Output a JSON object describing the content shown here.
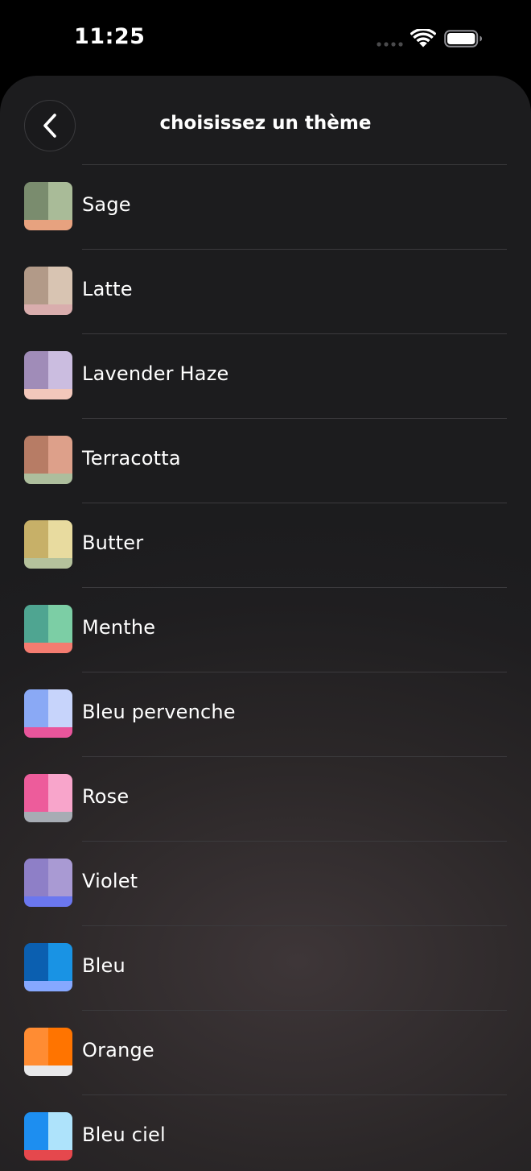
{
  "status_bar": {
    "time": "11:25",
    "icons": [
      "cellular-signal-icon",
      "wifi-icon",
      "battery-icon"
    ]
  },
  "header": {
    "title": "choisissez un thème",
    "back_icon": "chevron-left-icon"
  },
  "themes": [
    {
      "name": "Sage",
      "colors": [
        "#7a8c6e",
        "#a9bb98",
        "#e7a27f"
      ]
    },
    {
      "name": "Latte",
      "colors": [
        "#b29a88",
        "#d8c4b2",
        "#d9adad"
      ]
    },
    {
      "name": "Lavender Haze",
      "colors": [
        "#a08cb8",
        "#cbbde0",
        "#f2c7bb"
      ]
    },
    {
      "name": "Terracotta",
      "colors": [
        "#b77c65",
        "#dda08a",
        "#adbe9d"
      ]
    },
    {
      "name": "Butter",
      "colors": [
        "#c7b068",
        "#e8db9f",
        "#b5c29c"
      ]
    },
    {
      "name": "Menthe",
      "colors": [
        "#4fa591",
        "#7ccea5",
        "#f47c70"
      ]
    },
    {
      "name": "Bleu pervenche",
      "colors": [
        "#8aa9f5",
        "#c7d4fb",
        "#e8559b"
      ]
    },
    {
      "name": "Rose",
      "colors": [
        "#ed5c9b",
        "#f8a5cb",
        "#a7acb4"
      ]
    },
    {
      "name": "Violet",
      "colors": [
        "#8e7fc7",
        "#a99ad3",
        "#6b77ef"
      ]
    },
    {
      "name": "Bleu",
      "colors": [
        "#0b5fb0",
        "#1993e4",
        "#86a8ff"
      ]
    },
    {
      "name": "Orange",
      "colors": [
        "#ff8c33",
        "#ff7400",
        "#e8e8ea"
      ]
    },
    {
      "name": "Bleu ciel",
      "colors": [
        "#1d8ef0",
        "#aee3fb",
        "#e5484d"
      ]
    }
  ]
}
